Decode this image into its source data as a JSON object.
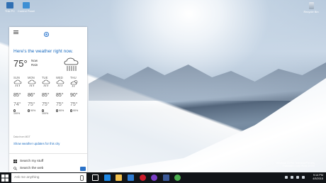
{
  "desktop": {
    "icons": [
      {
        "label": "This PC",
        "color": "#2f6fb3"
      },
      {
        "label": "Control Panel",
        "color": "#3d8fd4"
      }
    ],
    "recycle_bin_label": "Recycle Bin",
    "watermark_line1": "Windows 10 Pro Technical Preview",
    "watermark_line2": "Evaluation copy. Build 10130"
  },
  "cortana": {
    "headline": "Here's the weather right now.",
    "current": {
      "temp": "75°",
      "line1": "Now",
      "line2": "Rain"
    },
    "days": [
      {
        "day": "SUN",
        "icon": "rain-cloud-icon",
        "high": "85°",
        "low": "74°",
        "precip": "100%"
      },
      {
        "day": "MON",
        "icon": "rain-cloud-icon",
        "high": "86°",
        "low": "75°",
        "precip": "90%"
      },
      {
        "day": "TUE",
        "icon": "rain-cloud-icon",
        "high": "85°",
        "low": "75°",
        "precip": "100%"
      },
      {
        "day": "WED",
        "icon": "rain-cloud-icon",
        "high": "85°",
        "low": "75°",
        "precip": "90%"
      },
      {
        "day": "THU",
        "icon": "sun-rain-icon",
        "high": "90°",
        "low": "75°",
        "precip": "90%"
      }
    ],
    "source": "Data from MDT",
    "link": "Show weather updates for this city",
    "search_my_stuff": "Search my stuff",
    "search_web": "Search the web"
  },
  "taskbar": {
    "search_placeholder": "Ask me anything",
    "time": "9:14 PM",
    "date": "4/5/2015",
    "apps": [
      {
        "name": "task-view-icon",
        "color": "#ffffff"
      },
      {
        "name": "edge-icon",
        "color": "#1e88e5"
      },
      {
        "name": "file-explorer-icon",
        "color": "#f2c14e"
      },
      {
        "name": "store-icon",
        "color": "#2e7bd1"
      },
      {
        "name": "opera-icon",
        "color": "#cc1b2b"
      },
      {
        "name": "media-icon",
        "color": "#7a3fc6"
      },
      {
        "name": "facebook-icon",
        "color": "#3b5998"
      },
      {
        "name": "chrome-icon",
        "color": "#4caf50"
      }
    ]
  },
  "colors": {
    "accent": "#1c6cc0",
    "taskbar": "#111418",
    "panel": "#ffffff"
  }
}
